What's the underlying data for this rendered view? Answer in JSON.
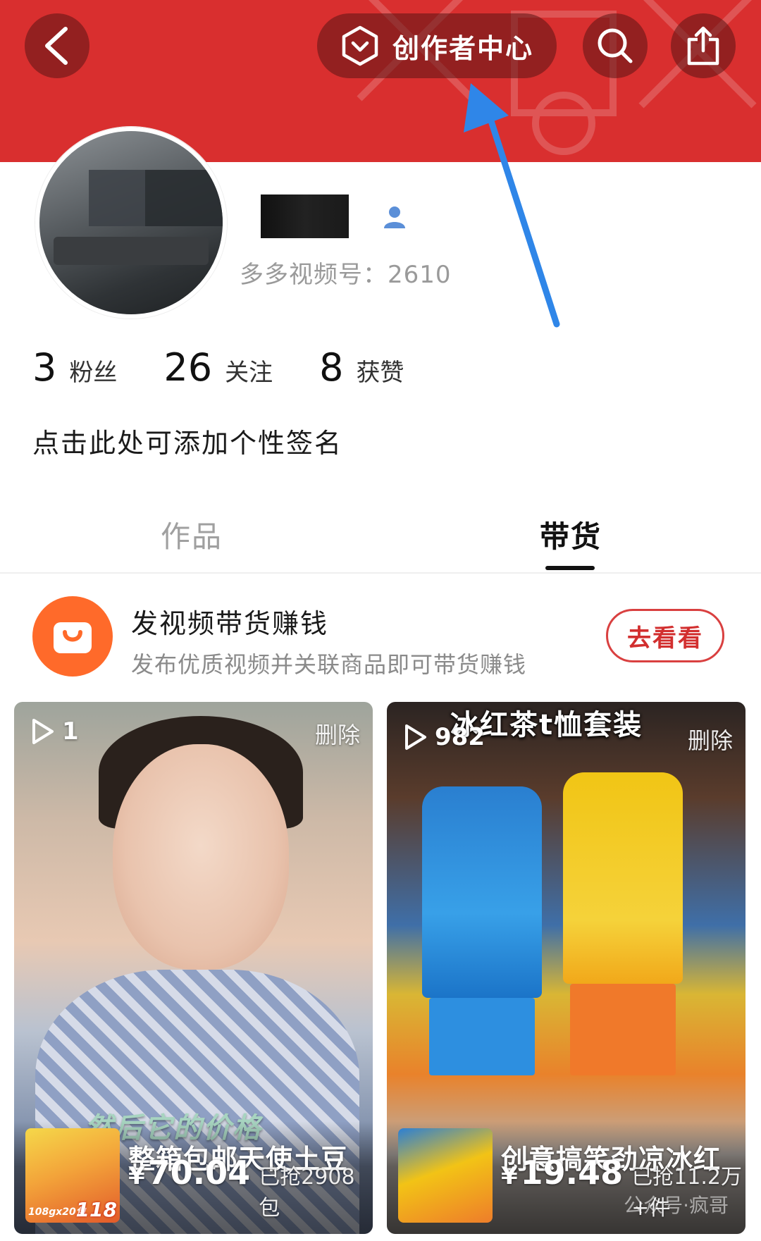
{
  "header": {
    "back_icon": "chevron-left-icon",
    "creator_center_label": "创作者中心",
    "creator_icon": "hexagon-check-icon",
    "search_icon": "search-icon",
    "share_icon": "share-icon",
    "brand_color": "#d92f2f"
  },
  "profile": {
    "duoduo_id": "多多视频号：2610",
    "stats": [
      {
        "value": "3",
        "label": "粉丝"
      },
      {
        "value": "26",
        "label": "关注"
      },
      {
        "value": "8",
        "label": "获赞"
      }
    ],
    "signature": "点击此处可添加个性签名"
  },
  "tabs": [
    {
      "label": "作品",
      "active": false
    },
    {
      "label": "带货",
      "active": true
    }
  ],
  "promo": {
    "title": "发视频带货赚钱",
    "subtitle": "发布优质视频并关联商品即可带货赚钱",
    "button_label": "去看看",
    "icon": "shopping-bag-icon",
    "icon_color": "#ff6a2a"
  },
  "videos": [
    {
      "play_count": "1",
      "delete_label": "删除",
      "caption": "然后它的价格",
      "product_title": "整箱包邮天使土豆",
      "currency": "¥",
      "price": "70.04",
      "sold": "已抢2908包",
      "thumb_text": "108gx20包",
      "thumb_price": "118"
    },
    {
      "play_count": "982",
      "delete_label": "删除",
      "banner": "冰红茶t恤套装",
      "product_title": "创意搞笑劲凉冰红",
      "currency": "¥",
      "price": "19.48",
      "sold": "已抢11.2万+件",
      "watermark": "公众号·疯哥"
    }
  ]
}
